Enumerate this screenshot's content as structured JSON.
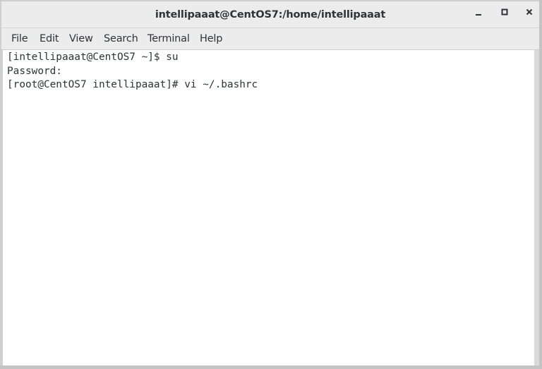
{
  "window": {
    "title": "intellipaaat@CentOS7:/home/intellipaaat"
  },
  "window_controls": {
    "minimize_icon": "minimize-icon",
    "maximize_icon": "maximize-icon",
    "close_icon": "close-icon"
  },
  "menubar": {
    "items": [
      {
        "label": "File"
      },
      {
        "label": "Edit"
      },
      {
        "label": "View"
      },
      {
        "label": "Search"
      },
      {
        "label": "Terminal"
      },
      {
        "label": "Help"
      }
    ]
  },
  "terminal": {
    "lines": [
      "[intellipaaat@CentOS7 ~]$ su",
      "Password:",
      "[root@CentOS7 intellipaaat]# vi ~/.bashrc"
    ]
  },
  "colors": {
    "titlebar_bg": "#ececec",
    "terminal_bg": "#ffffff",
    "text": "#2e3436"
  }
}
